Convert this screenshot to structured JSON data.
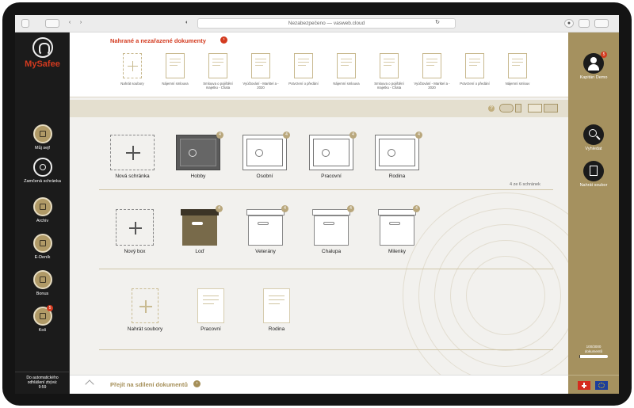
{
  "browser": {
    "address": "Nezabezpečeno — vasweb.cloud"
  },
  "brand": {
    "name": "MySafee"
  },
  "sidebar_left": {
    "items": [
      {
        "label": "Můj sejf",
        "icon": "safe-icon"
      },
      {
        "label": "Zamčená schránka",
        "icon": "lock-icon"
      },
      {
        "label": "Archiv",
        "icon": "archive-icon"
      },
      {
        "label": "E-Deník",
        "icon": "diary-icon"
      },
      {
        "label": "Bonus",
        "icon": "gift-icon"
      },
      {
        "label": "Koš",
        "icon": "trash-icon",
        "badge": "5"
      }
    ],
    "autologout": [
      "Do automatického",
      "odhlášení zbývá:",
      "9:59"
    ]
  },
  "sidebar_right": {
    "user": {
      "name": "Kapitán Demo",
      "badge": "5"
    },
    "actions": [
      {
        "label": "Vyhledat",
        "icon": "search-icon"
      },
      {
        "label": "Nahrát soubor",
        "icon": "upload-icon"
      }
    ],
    "doc_count": [
      "100/3000",
      "dokumentů"
    ],
    "doc_fraction": 0.033,
    "flags": [
      "CH",
      "EU"
    ]
  },
  "top_strip": {
    "title": "Nahrané a nezařazené dokumenty",
    "items": [
      {
        "label": "Nahrát soubory",
        "type": "upload"
      },
      {
        "label": "Nájemní smlouva",
        "type": "doc"
      },
      {
        "label": "Smlouva o pojištění majetku - Chata",
        "type": "doc"
      },
      {
        "label": "Vyúčtování - Marktel a - 2020",
        "type": "doc"
      },
      {
        "label": "Potvrzení o předání",
        "type": "doc"
      },
      {
        "label": "Nájemní smlouva",
        "type": "doc"
      },
      {
        "label": "Smlouva o pojištění majetku - Chata",
        "type": "doc"
      },
      {
        "label": "Vyúčtování - Marktel a - 2020",
        "type": "doc"
      },
      {
        "label": "Potvrzení o předání",
        "type": "doc"
      },
      {
        "label": "Nájemní smlouv",
        "type": "doc"
      }
    ]
  },
  "safes": {
    "items": [
      {
        "label": "Nová schránka",
        "type": "new"
      },
      {
        "label": "Hobby",
        "type": "dark",
        "count": "4"
      },
      {
        "label": "Osobní",
        "type": "light",
        "count": "4"
      },
      {
        "label": "Pracovní",
        "type": "light",
        "count": "4"
      },
      {
        "label": "Rodina",
        "type": "light",
        "count": "4"
      }
    ],
    "summary": "4 ze 6 schránek"
  },
  "boxes": {
    "items": [
      {
        "label": "Nový box",
        "type": "new"
      },
      {
        "label": "Loď",
        "type": "dark",
        "count": "4"
      },
      {
        "label": "Veterány",
        "type": "light",
        "count": "4"
      },
      {
        "label": "Chalupa",
        "type": "light",
        "count": "4"
      },
      {
        "label": "Milenky",
        "type": "light",
        "count": "4"
      }
    ]
  },
  "docs": {
    "items": [
      {
        "label": "Nahrát soubory",
        "type": "new"
      },
      {
        "label": "Pracovní",
        "type": "doc"
      },
      {
        "label": "Rodina",
        "type": "doc"
      }
    ]
  },
  "bottom": {
    "share_label": "Přejít na sdílení dokumentů"
  },
  "colors": {
    "accent": "#d33a1f",
    "gold": "#a5915f",
    "dark": "#1b1b1b"
  }
}
